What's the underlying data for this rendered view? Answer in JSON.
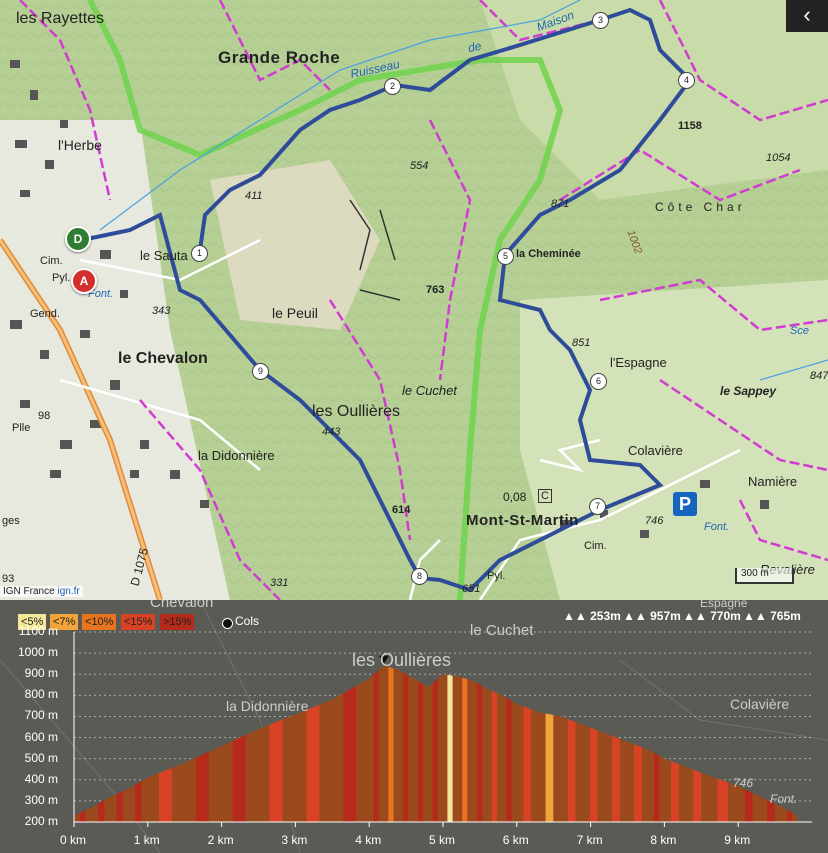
{
  "map": {
    "places": {
      "les_rayettes": "les Rayettes",
      "grande_roche": "Grande Roche",
      "ruisseau": "Ruisseau",
      "de": "de",
      "maison": "Maison",
      "lherbe": "l'Herbe",
      "le_sauta": "le Sauta",
      "cim": "Cim.",
      "pyl": "Pyl.",
      "font": "Font.",
      "gend": "Gend.",
      "le_chevalon": "le Chevalon",
      "le_peuil": "le Peuil",
      "les_oullieres": "les Oullières",
      "la_didonniere": "la Didonnière",
      "le_cuchet": "le Cuchet",
      "la_cheminee": "la Cheminée",
      "lespagne": "l'Espagne",
      "le_sappey": "le Sappey",
      "colaviere": "Colavière",
      "namiere": "Namière",
      "mont_st_martin": "Mont-St-Martin",
      "cim2": "Cim.",
      "font2": "Font.",
      "pyl2": "Pyl.",
      "revaliere": "Revalière",
      "cote_char": "Côte Char",
      "sce": "Sce",
      "road": "D 1075",
      "ges": "ges",
      "plle": "Plle",
      "num_98": "98",
      "marker_c": "C",
      "val_008": "0,08"
    },
    "altitudes": {
      "a1158": "1158",
      "a1054": "1054",
      "a871": "871",
      "a1002": "1002",
      "a554": "554",
      "a411": "411",
      "a763": "763",
      "a343": "343",
      "a851": "851",
      "a443": "443",
      "a614": "614",
      "a746": "746",
      "a331": "331",
      "a847": "847",
      "a651": "651",
      "a93": "93"
    },
    "waypoints": [
      "1",
      "2",
      "3",
      "4",
      "5",
      "6",
      "7",
      "8",
      "9"
    ],
    "pin_start": "D",
    "pin_arrival": "A",
    "parking": "P",
    "scale": "300 m",
    "attribution_prefix": "IGN France ",
    "attribution_link": "ign.fr",
    "collapse_icon": "chevron-left"
  },
  "profile": {
    "legend": [
      "<5%",
      "<7%",
      "<10%",
      "<15%",
      ">15%"
    ],
    "legend_colors": [
      "#f5e79a",
      "#f2a33a",
      "#e8741f",
      "#d84325",
      "#b52a1a"
    ],
    "cols_label": "Cols",
    "stats": [
      "253m",
      "957m",
      "770m",
      "765m"
    ],
    "background_labels": {
      "chevalon": "Chevalon",
      "cuchet": "le Cuchet",
      "oullieres": "les Oullières",
      "didonniere": "la Didonnière",
      "colaviere": "Colavière",
      "espagne": "Espagne",
      "font": "Font.",
      "a746": "746"
    }
  },
  "chart_data": {
    "type": "area",
    "x": [
      0,
      0.25,
      0.5,
      0.75,
      1,
      1.5,
      2,
      2.5,
      3,
      3.5,
      4,
      4.2,
      4.4,
      4.6,
      4.8,
      5,
      5.2,
      5.4,
      5.6,
      5.8,
      6,
      6.3,
      6.6,
      6.9,
      7.2,
      7.5,
      7.8,
      8,
      8.3,
      8.6,
      9,
      9.3,
      9.6,
      9.8
    ],
    "y": [
      230,
      270,
      320,
      360,
      410,
      480,
      560,
      640,
      710,
      780,
      880,
      940,
      920,
      880,
      840,
      900,
      890,
      870,
      830,
      800,
      760,
      720,
      700,
      660,
      620,
      580,
      540,
      500,
      460,
      420,
      370,
      320,
      270,
      230
    ],
    "xticks": [
      "0 km",
      "1 km",
      "2 km",
      "3 km",
      "4 km",
      "5 km",
      "6 km",
      "7 km",
      "8 km",
      "9 km"
    ],
    "yticks": [
      "200 m",
      "300 m",
      "400 m",
      "500 m",
      "600 m",
      "700 m",
      "800 m",
      "900 m",
      "1000 m",
      "1100 m"
    ],
    "xlim": [
      0,
      10
    ],
    "ylim": [
      200,
      1100
    ],
    "grid": true,
    "fill_color": "#9b4a1e"
  }
}
